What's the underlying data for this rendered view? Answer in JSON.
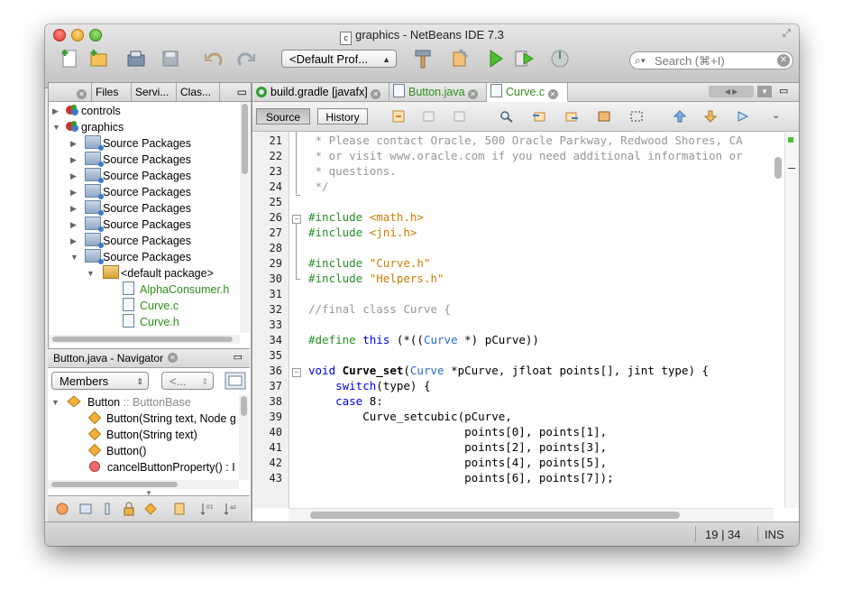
{
  "window": {
    "title": "graphics - NetBeans IDE 7.3",
    "file_badge": "c"
  },
  "toolbar": {
    "profile_select": "<Default Prof...",
    "search_placeholder": "Search (⌘+I)"
  },
  "projects_pane": {
    "tabs": [
      {
        "label": "Files"
      },
      {
        "label": "Servi..."
      },
      {
        "label": "Clas..."
      }
    ],
    "tree": [
      {
        "label": "controls",
        "kind": "project",
        "expanded": false
      },
      {
        "label": "graphics",
        "kind": "project",
        "expanded": true
      },
      {
        "label": "Source Packages",
        "kind": "package",
        "expanded": false
      },
      {
        "label": "Source Packages",
        "kind": "package",
        "expanded": false
      },
      {
        "label": "Source Packages",
        "kind": "package",
        "expanded": false
      },
      {
        "label": "Source Packages",
        "kind": "package",
        "expanded": false
      },
      {
        "label": "Source Packages",
        "kind": "package",
        "expanded": false
      },
      {
        "label": "Source Packages",
        "kind": "package",
        "expanded": false
      },
      {
        "label": "Source Packages",
        "kind": "package",
        "expanded": false
      },
      {
        "label": "Source Packages",
        "kind": "package",
        "expanded": true
      },
      {
        "label": "<default package>",
        "kind": "defpkg",
        "expanded": true
      },
      {
        "label": "AlphaConsumer.h",
        "kind": "file"
      },
      {
        "label": "Curve.c",
        "kind": "file"
      },
      {
        "label": "Curve.h",
        "kind": "file"
      }
    ]
  },
  "navigator": {
    "title": "Button.java - Navigator",
    "members_select": "Members",
    "filter_select": "<...",
    "items": [
      {
        "name": "Button",
        "suffix": " :: ButtonBase",
        "kind": "class"
      },
      {
        "name": "Button(String text, Node g",
        "kind": "ctor"
      },
      {
        "name": "Button(String text)",
        "kind": "ctor"
      },
      {
        "name": "Button()",
        "kind": "ctor"
      },
      {
        "name": "cancelButtonProperty() : I",
        "kind": "method"
      }
    ]
  },
  "editor": {
    "tabs": [
      {
        "label": "build.gradle [javafx]"
      },
      {
        "label": "Button.java"
      },
      {
        "label": "Curve.c"
      }
    ],
    "source_label": "Source",
    "history_label": "History",
    "lines": [
      {
        "n": "21",
        "text": " * Please contact Oracle, 500 Oracle Parkway, Redwood Shores, CA"
      },
      {
        "n": "22",
        "text": " * or visit www.oracle.com if you need additional information or"
      },
      {
        "n": "23",
        "text": " * questions."
      },
      {
        "n": "24",
        "text": " */"
      },
      {
        "n": "25",
        "text": ""
      },
      {
        "n": "26",
        "text": "#include <math.h>"
      },
      {
        "n": "27",
        "text": "#include <jni.h>"
      },
      {
        "n": "28",
        "text": ""
      },
      {
        "n": "29",
        "text": "#include \"Curve.h\""
      },
      {
        "n": "30",
        "text": "#include \"Helpers.h\""
      },
      {
        "n": "31",
        "text": ""
      },
      {
        "n": "32",
        "text": "//final class Curve {"
      },
      {
        "n": "33",
        "text": ""
      },
      {
        "n": "34",
        "text": "#define this (*((Curve *) pCurve))"
      },
      {
        "n": "35",
        "text": ""
      },
      {
        "n": "36",
        "text": "void Curve_set(Curve *pCurve, jfloat points[], jint type) {"
      },
      {
        "n": "37",
        "text": "    switch(type) {"
      },
      {
        "n": "38",
        "text": "    case 8:"
      },
      {
        "n": "39",
        "text": "        Curve_setcubic(pCurve,"
      },
      {
        "n": "40",
        "text": "                       points[0], points[1],"
      },
      {
        "n": "41",
        "text": "                       points[2], points[3],"
      },
      {
        "n": "42",
        "text": "                       points[4], points[5],"
      },
      {
        "n": "43",
        "text": "                       points[6], points[7]);"
      }
    ]
  },
  "status": {
    "position": "19 | 34",
    "mode": "INS"
  }
}
